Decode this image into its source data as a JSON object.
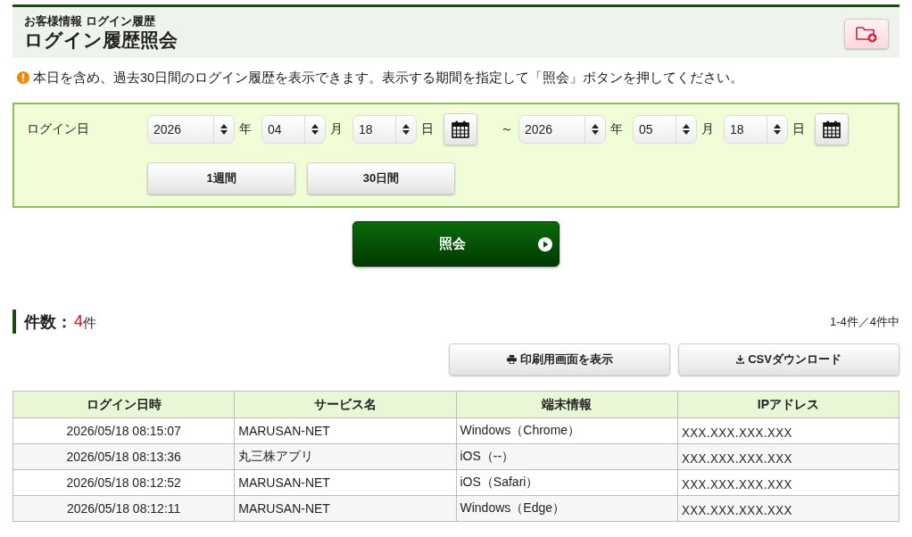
{
  "header": {
    "breadcrumb": "お客様情報 ログイン履歴",
    "title": "ログイン履歴照会"
  },
  "notice": "本日を含め、過去30日間のログイン履歴を表示できます。表示する期間を指定して「照会」ボタンを押してください。",
  "filter": {
    "label": "ログイン日",
    "date_from": [
      {
        "value": "2026",
        "unit": "年"
      },
      {
        "value": "04",
        "unit": "月"
      },
      {
        "value": "18",
        "unit": "日"
      }
    ],
    "separator": "～",
    "date_to": [
      {
        "value": "2026",
        "unit": "年"
      },
      {
        "value": "05",
        "unit": "月"
      },
      {
        "value": "18",
        "unit": "日"
      }
    ],
    "quick_buttons": [
      "1週間",
      "30日間"
    ]
  },
  "search_button": "照会",
  "results": {
    "count_label": "件数：",
    "count": "4",
    "count_unit": "件",
    "range": "1-4件／4件中"
  },
  "actions": [
    {
      "kind": "print",
      "label": "印刷用画面を表示"
    },
    {
      "kind": "download",
      "label": "CSVダウンロード"
    }
  ],
  "table": {
    "columns": [
      "ログイン日時",
      "サービス名",
      "端末情報",
      "IPアドレス"
    ],
    "rows": [
      [
        "2026/05/18 08:15:07",
        "MARUSAN-NET",
        "Windows（Chrome）",
        "XXX.XXX.XXX.XXX"
      ],
      [
        "2026/05/18 08:13:36",
        "丸三株アプリ",
        "iOS（--）",
        "XXX.XXX.XXX.XXX"
      ],
      [
        "2026/05/18 08:12:52",
        "MARUSAN-NET",
        "iOS（Safari）",
        "XXX.XXX.XXX.XXX"
      ],
      [
        "2026/05/18 08:12:11",
        "MARUSAN-NET",
        "Windows（Edge）",
        "XXX.XXX.XXX.XXX"
      ]
    ]
  }
}
